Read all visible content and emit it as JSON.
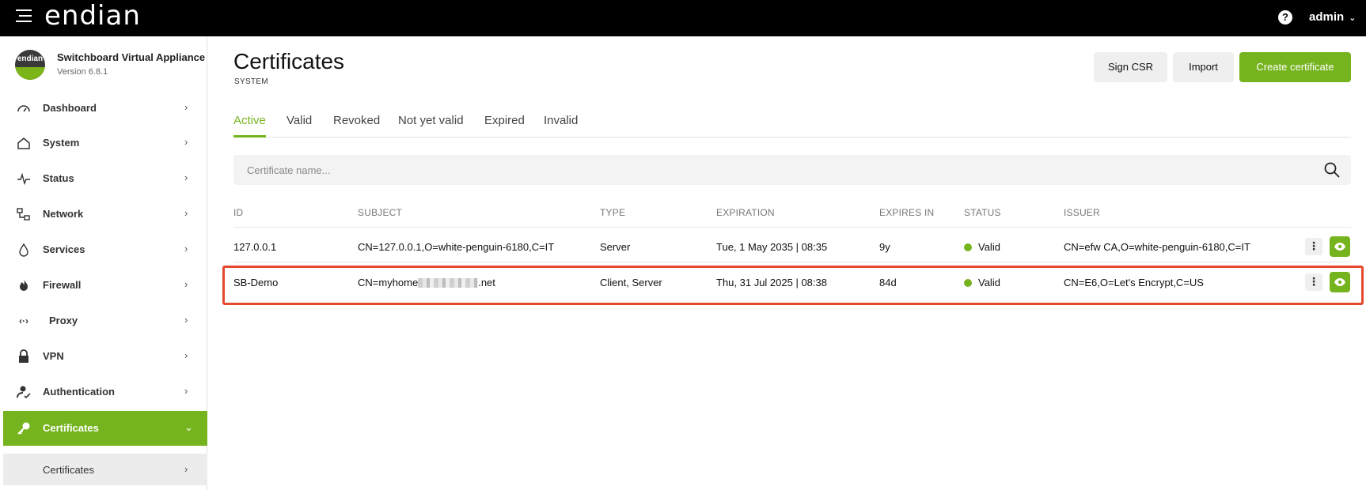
{
  "topbar": {
    "brand": "endian",
    "help_label": "?",
    "user": "admin"
  },
  "sidebar": {
    "app_name": "Switchboard Virtual Appliance",
    "app_version": "Version 6.8.1",
    "logo_text": "endian",
    "items": [
      {
        "label": "Dashboard",
        "icon": "gauge-icon"
      },
      {
        "label": "System",
        "icon": "home-icon"
      },
      {
        "label": "Status",
        "icon": "pulse-icon"
      },
      {
        "label": "Network",
        "icon": "network-icon"
      },
      {
        "label": "Services",
        "icon": "droplet-icon"
      },
      {
        "label": "Firewall",
        "icon": "flame-icon"
      },
      {
        "label": "Proxy",
        "icon": "proxy-arrows-icon"
      },
      {
        "label": "VPN",
        "icon": "lock-icon"
      },
      {
        "label": "Authentication",
        "icon": "user-check-icon"
      },
      {
        "label": "Certificates",
        "icon": "key-icon",
        "active": true
      }
    ],
    "sub_items": [
      {
        "label": "Certificates"
      }
    ]
  },
  "main": {
    "title": "Certificates",
    "subtitle": "SYSTEM",
    "buttons": {
      "sign_csr": "Sign CSR",
      "import": "Import",
      "create": "Create certificate"
    },
    "tabs": [
      "Active",
      "Valid",
      "Revoked",
      "Not yet valid",
      "Expired",
      "Invalid"
    ],
    "search": {
      "placeholder": "Certificate name..."
    },
    "table": {
      "headers": [
        "ID",
        "SUBJECT",
        "TYPE",
        "EXPIRATION",
        "EXPIRES IN",
        "STATUS",
        "ISSUER"
      ],
      "rows": [
        {
          "id": "127.0.0.1",
          "subject": "CN=127.0.0.1,O=white-penguin-6180,C=IT",
          "type": "Server",
          "expiration": "Tue, 1 May 2035 | 08:35",
          "expires_in": "9y",
          "status": "Valid",
          "issuer": "CN=efw CA,O=white-penguin-6180,C=IT"
        },
        {
          "id": "SB-Demo",
          "subject_prefix": "CN=myhome",
          "subject_suffix": ".net",
          "type": "Client, Server",
          "expiration": "Thu, 31 Jul 2025 | 08:38",
          "expires_in": "84d",
          "status": "Valid",
          "issuer": "CN=E6,O=Let's Encrypt,C=US"
        }
      ]
    }
  },
  "colors": {
    "accent": "#76b41f",
    "highlight": "#e5482d",
    "topbar": "#000000"
  }
}
